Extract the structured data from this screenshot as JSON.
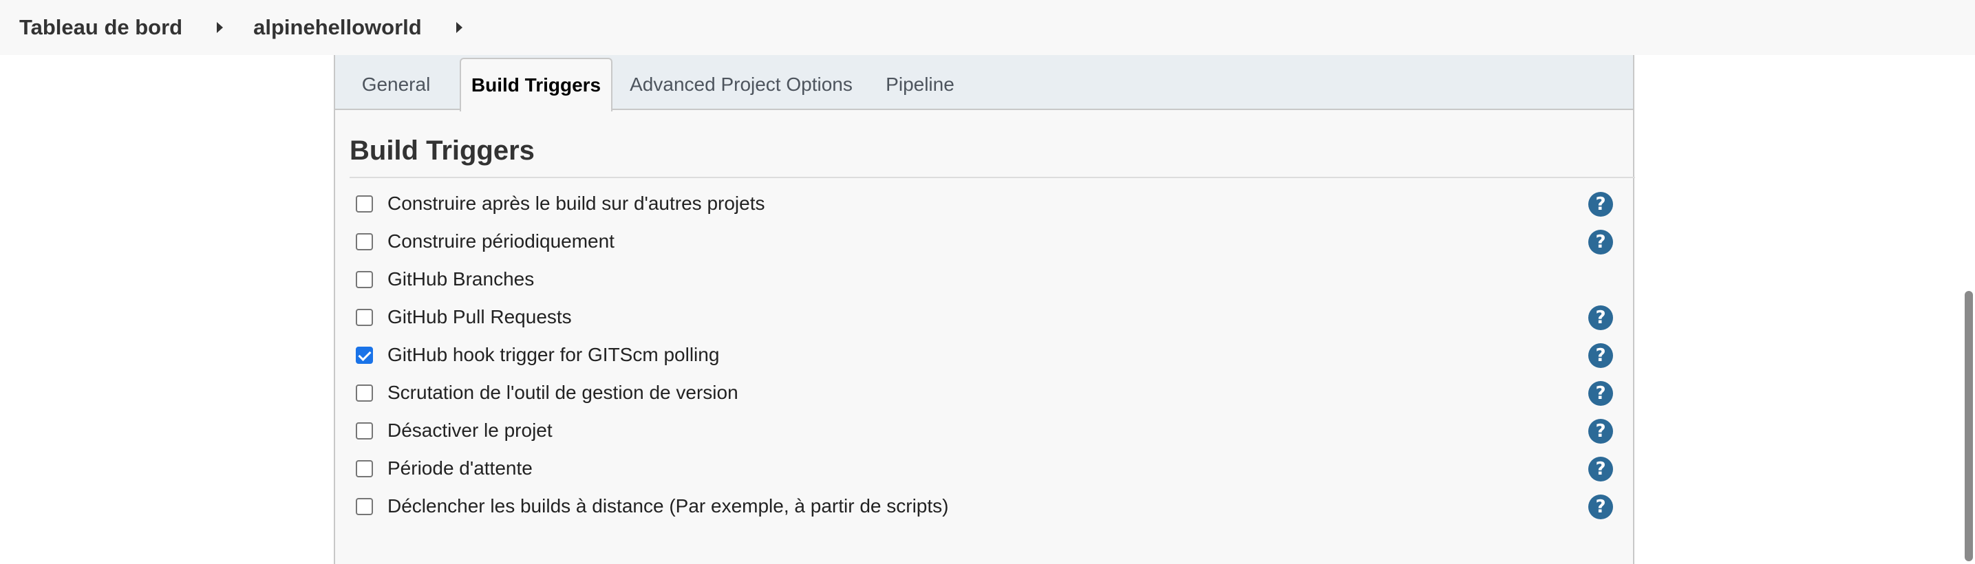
{
  "breadcrumb": {
    "items": [
      {
        "label": "Tableau de bord"
      },
      {
        "label": "alpinehelloworld"
      }
    ]
  },
  "tabs": [
    {
      "label": "General",
      "active": false
    },
    {
      "label": "Build Triggers",
      "active": true
    },
    {
      "label": "Advanced Project Options",
      "active": false
    },
    {
      "label": "Pipeline",
      "active": false
    }
  ],
  "section": {
    "title": "Build Triggers"
  },
  "triggers": [
    {
      "label": "Construire après le build sur d'autres projets",
      "checked": false,
      "help": true
    },
    {
      "label": "Construire périodiquement",
      "checked": false,
      "help": true
    },
    {
      "label": "GitHub Branches",
      "checked": false,
      "help": false
    },
    {
      "label": "GitHub Pull Requests",
      "checked": false,
      "help": true
    },
    {
      "label": "GitHub hook trigger for GITScm polling",
      "checked": true,
      "help": true
    },
    {
      "label": "Scrutation de l'outil de gestion de version",
      "checked": false,
      "help": true
    },
    {
      "label": "Désactiver le projet",
      "checked": false,
      "help": true
    },
    {
      "label": "Période d'attente",
      "checked": false,
      "help": true
    },
    {
      "label": "Déclencher les builds à distance (Par exemple, à partir de scripts)",
      "checked": false,
      "help": true
    }
  ],
  "help_icon": {
    "glyph": "?",
    "icon": "help-icon"
  },
  "colors": {
    "accent": "#1a73e8",
    "help_icon": "#2c6a97",
    "tab_strip": "#e9eef2",
    "panel_bg": "#f8f8f8"
  }
}
